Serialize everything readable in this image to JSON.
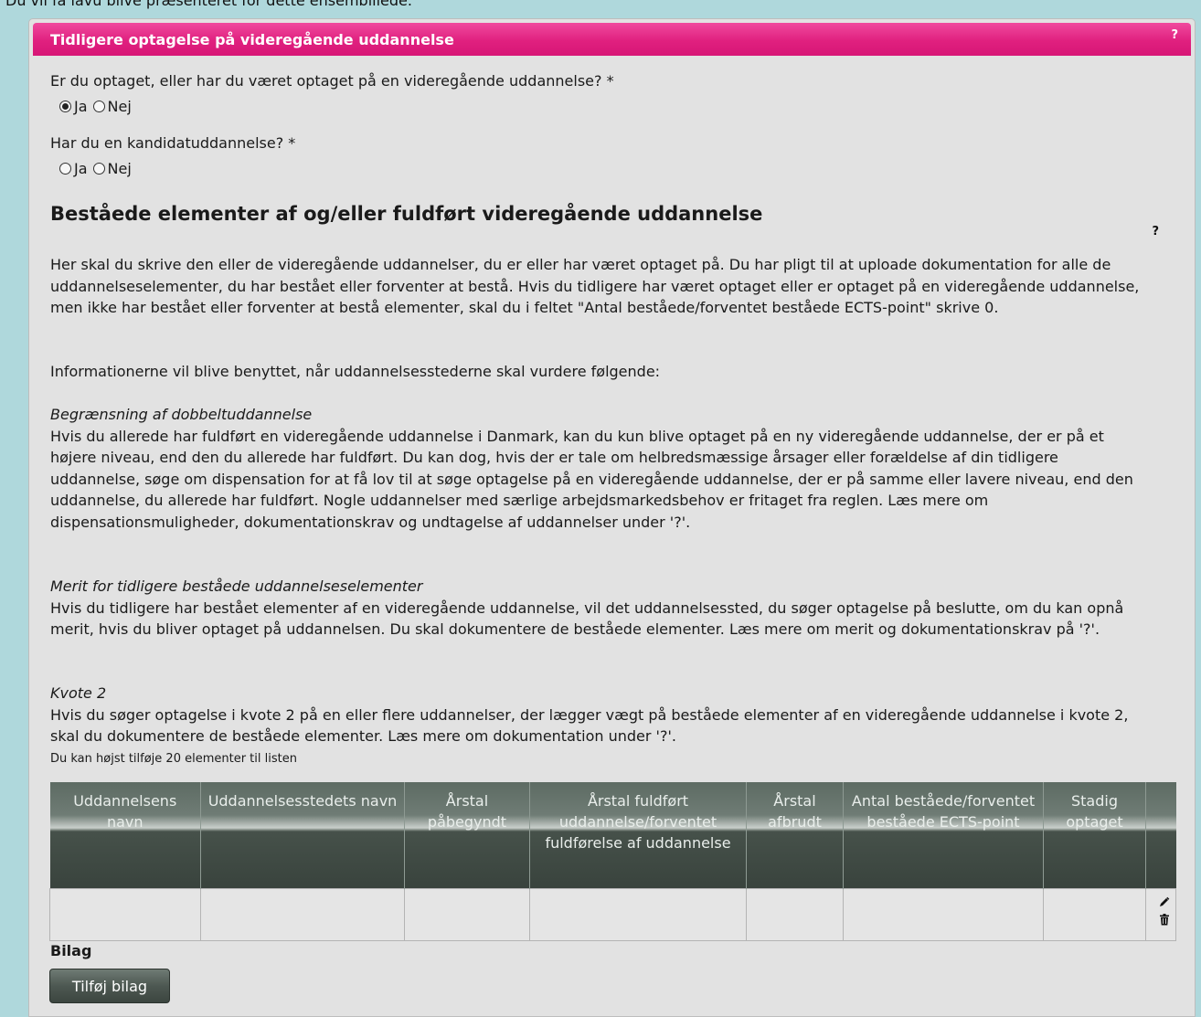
{
  "top_caption": "Du vil få lavu blive præsenteret for dette ensemblilede.",
  "panel": {
    "title": "Tidligere optagelse på videregående uddannelse",
    "help_label": "?"
  },
  "questions": [
    {
      "label": "Er du optaget, eller har du været optaget på en videregående uddannelse? *",
      "options": [
        {
          "label": "Ja",
          "checked": true
        },
        {
          "label": "Nej",
          "checked": false
        }
      ]
    },
    {
      "label": "Har du en kandidatuddannelse? *",
      "options": [
        {
          "label": "Ja",
          "checked": false
        },
        {
          "label": "Nej",
          "checked": false
        }
      ]
    }
  ],
  "section": {
    "title": "Beståede elementer af og/eller fuldført videregående uddannelse",
    "help_label": "?",
    "intro": "Her skal du skrive den eller de videregående uddannelser, du er eller har været optaget på. Du har pligt til at uploade dokumentation for alle de uddannelseselementer, du har bestået eller forventer at bestå. Hvis du tidligere har været optaget eller er optaget på en videregående uddannelse, men ikke har bestået eller forventer at bestå elementer, skal du i feltet \"Antal beståede/forventet beståede ECTS-point\" skrive 0.",
    "info_line": "Informationerne vil blive benyttet, når uddannelsesstederne skal vurdere følgende:",
    "blocks": [
      {
        "title": "Begrænsning af dobbeltuddannelse",
        "text": "Hvis du allerede har fuldført en videregående uddannelse i Danmark, kan du kun blive optaget på en ny videregående uddannelse, der er på et højere niveau, end den du allerede har fuldført. Du kan dog, hvis der er tale om helbredsmæssige årsager eller forældelse af din tidligere uddannelse, søge om dispensation for at få lov til at søge optagelse på en videregående uddannelse, der er på samme eller lavere niveau, end den uddannelse, du allerede har fuldført. Nogle uddannelser med særlige arbejdsmarkedsbehov er fritaget fra reglen. Læs mere om dispensationsmuligheder, dokumentationskrav og undtagelse af uddannelser under '?'."
      },
      {
        "title": "Merit for tidligere beståede uddannelseselementer",
        "text": "Hvis du tidligere har bestået elementer af en videregående uddannelse, vil det uddannelsessted, du søger optagelse på beslutte, om du kan opnå merit, hvis du bliver optaget på uddannelsen. Du skal dokumentere de beståede elementer. Læs mere om merit og dokumentationskrav på '?'."
      },
      {
        "title": "Kvote 2",
        "text": "Hvis du søger optagelse i kvote 2 på en eller flere uddannelser, der lægger vægt på beståede elementer af en videregående uddannelse i kvote 2, skal du dokumentere de beståede elementer. Læs mere om dokumentation under '?'."
      }
    ],
    "limit_note": "Du kan højst tilføje 20 elementer til listen"
  },
  "table": {
    "columns": [
      "Uddannelsens navn",
      "Uddannelsesstedets navn",
      "Årstal påbegyndt",
      "Årstal fuldført uddannelse/forventet fuldførelse af uddannelse",
      "Årstal afbrudt",
      "Antal beståede/forventet beståede ECTS-point",
      "Stadig optaget",
      ""
    ],
    "rows": [
      [
        "",
        "",
        "",
        "",
        "",
        "",
        ""
      ]
    ],
    "row_icons": {
      "edit": "pencil-icon",
      "delete": "trash-icon"
    }
  },
  "attachments": {
    "label": "Bilag",
    "add_button": "Tilføj bilag"
  }
}
